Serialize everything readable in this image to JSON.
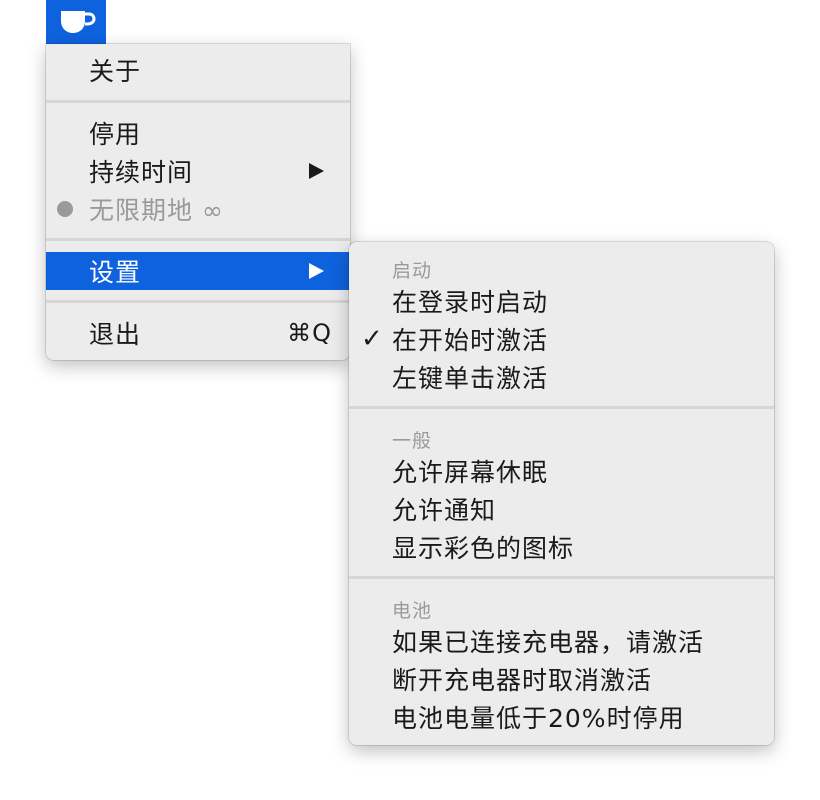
{
  "accent_color": "#0f62de",
  "menubar": {
    "icon": "coffee-cup-icon"
  },
  "main_menu": {
    "about": "关于",
    "disable": "停用",
    "duration": "持续时间",
    "indefinite": "无限期地 ∞",
    "settings": "设置",
    "quit": "退出",
    "quit_shortcut": "⌘Q"
  },
  "settings_menu": {
    "startup_header": "启动",
    "launch_at_login": "在登录时启动",
    "activate_on_launch": "在开始时激活",
    "activate_on_launch_checked": true,
    "left_click_activate": "左键单击激活",
    "general_header": "一般",
    "allow_screen_sleep": "允许屏幕休眠",
    "allow_notifications": "允许通知",
    "show_colored_icon": "显示彩色的图标",
    "battery_header": "电池",
    "activate_when_charging": "如果已连接充电器，请激活",
    "deactivate_on_disconnect": "断开充电器时取消激活",
    "disable_low_battery": "电池电量低于20%时停用"
  }
}
